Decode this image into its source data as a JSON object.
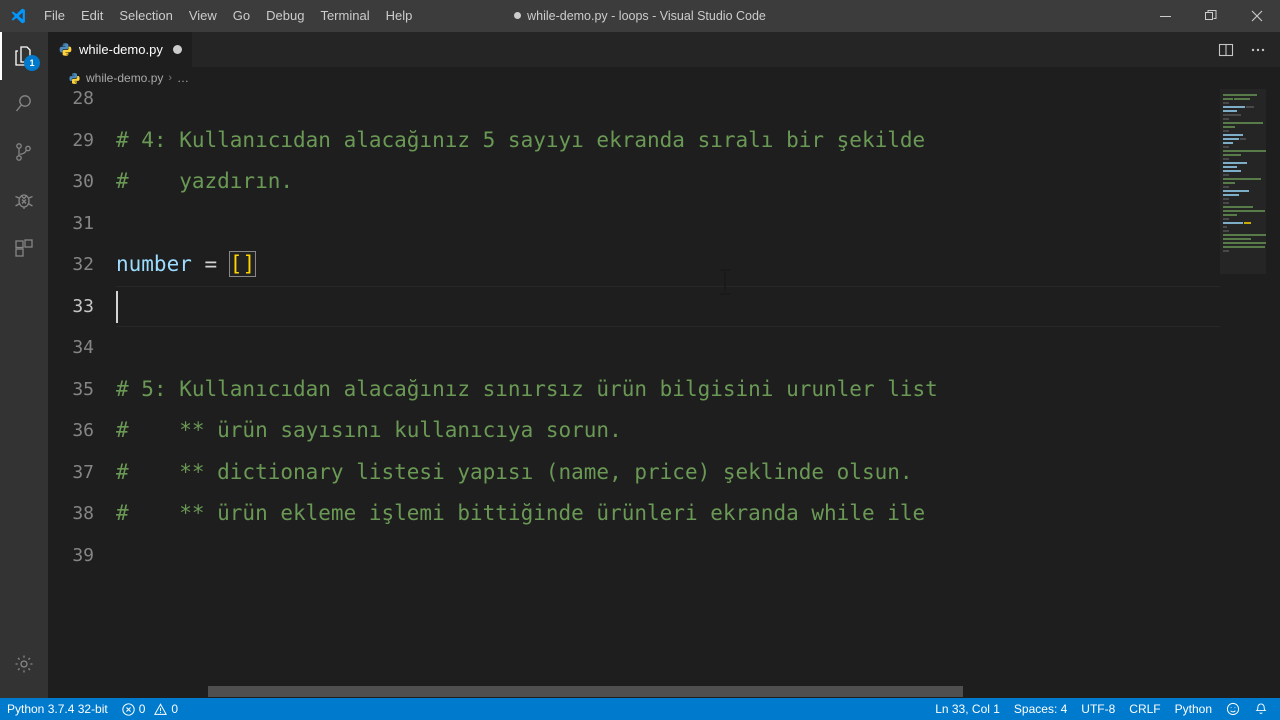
{
  "window": {
    "title": "while-demo.py - loops - Visual Studio Code",
    "dirty": true,
    "controls": {
      "minimize": "minimize-icon",
      "restore": "restore-icon",
      "close": "close-icon"
    }
  },
  "menubar": {
    "logo": "vscode-logo-icon",
    "items": [
      {
        "label": "File"
      },
      {
        "label": "Edit"
      },
      {
        "label": "Selection"
      },
      {
        "label": "View"
      },
      {
        "label": "Go"
      },
      {
        "label": "Debug"
      },
      {
        "label": "Terminal"
      },
      {
        "label": "Help"
      }
    ]
  },
  "activitybar": {
    "items": [
      {
        "name": "explorer",
        "icon": "files-icon",
        "active": true,
        "badge": "1"
      },
      {
        "name": "search",
        "icon": "search-icon",
        "active": false,
        "badge": ""
      },
      {
        "name": "source-control",
        "icon": "source-control-icon",
        "active": false,
        "badge": ""
      },
      {
        "name": "debug",
        "icon": "debug-icon",
        "active": false,
        "badge": ""
      },
      {
        "name": "extensions",
        "icon": "extensions-icon",
        "active": false,
        "badge": ""
      }
    ],
    "bottom": {
      "name": "manage",
      "icon": "gear-icon"
    }
  },
  "tabs": {
    "open": [
      {
        "label": "while-demo.py",
        "icon": "python-file-icon",
        "dirty": true,
        "active": true
      }
    ],
    "actions": [
      {
        "name": "split-editor",
        "icon": "split-editor-icon"
      },
      {
        "name": "more-actions",
        "icon": "ellipsis-icon"
      }
    ]
  },
  "breadcrumb": {
    "icon": "python-file-icon",
    "file": "while-demo.py",
    "separator": "›",
    "trailing": "…"
  },
  "editor": {
    "language": "Python",
    "cursor_line": 33,
    "lines": [
      {
        "num": "28",
        "text": "",
        "type": "comment",
        "partial": true
      },
      {
        "num": "29",
        "text": "# 4: Kullanıcıdan alacağınız 5 sayıyı ekranda sıralı bir şekilde",
        "type": "comment"
      },
      {
        "num": "30",
        "text": "#    yazdırın.",
        "type": "comment"
      },
      {
        "num": "31",
        "text": "",
        "type": "blank"
      },
      {
        "num": "32",
        "text": "number = []",
        "type": "code"
      },
      {
        "num": "33",
        "text": "",
        "type": "blank",
        "current": true
      },
      {
        "num": "34",
        "text": "",
        "type": "blank"
      },
      {
        "num": "35",
        "text": "# 5: Kullanıcıdan alacağınız sınırsız ürün bilgisini urunler list",
        "type": "comment"
      },
      {
        "num": "36",
        "text": "#    ** ürün sayısını kullanıcıya sorun.",
        "type": "comment"
      },
      {
        "num": "37",
        "text": "#    ** dictionary listesi yapısı (name, price) şeklinde olsun.",
        "type": "comment"
      },
      {
        "num": "38",
        "text": "#    ** ürün ekleme işlemi bittiğinde ürünleri ekranda while ile",
        "type": "comment"
      },
      {
        "num": "39",
        "text": "",
        "type": "blank"
      }
    ],
    "line32": {
      "variable": "number",
      "operator": " = ",
      "brackets": "[]"
    }
  },
  "statusbar": {
    "left": [
      {
        "name": "python-interpreter",
        "label": "Python 3.7.4 32-bit"
      },
      {
        "name": "problems",
        "errors": "0",
        "warnings": "0",
        "error_icon": "error-circle-icon",
        "warning_icon": "warning-triangle-icon"
      }
    ],
    "right": [
      {
        "name": "cursor-position",
        "label": "Ln 33, Col 1"
      },
      {
        "name": "indentation",
        "label": "Spaces: 4"
      },
      {
        "name": "encoding",
        "label": "UTF-8"
      },
      {
        "name": "eol",
        "label": "CRLF"
      },
      {
        "name": "language-mode",
        "label": "Python"
      },
      {
        "name": "feedback",
        "label": "☺"
      },
      {
        "name": "notifications",
        "label": "🔔"
      }
    ]
  },
  "colors": {
    "titlebar_bg": "#3c3c3c",
    "activitybar_bg": "#333333",
    "editor_bg": "#1e1e1e",
    "tabbar_bg": "#252526",
    "statusbar_bg": "#007acc",
    "comment_green": "#6A9955",
    "variable_blue": "#9CDCFE",
    "bracket_yellow": "#ffd700",
    "badge_blue": "#007acc",
    "line_number": "#858585"
  }
}
